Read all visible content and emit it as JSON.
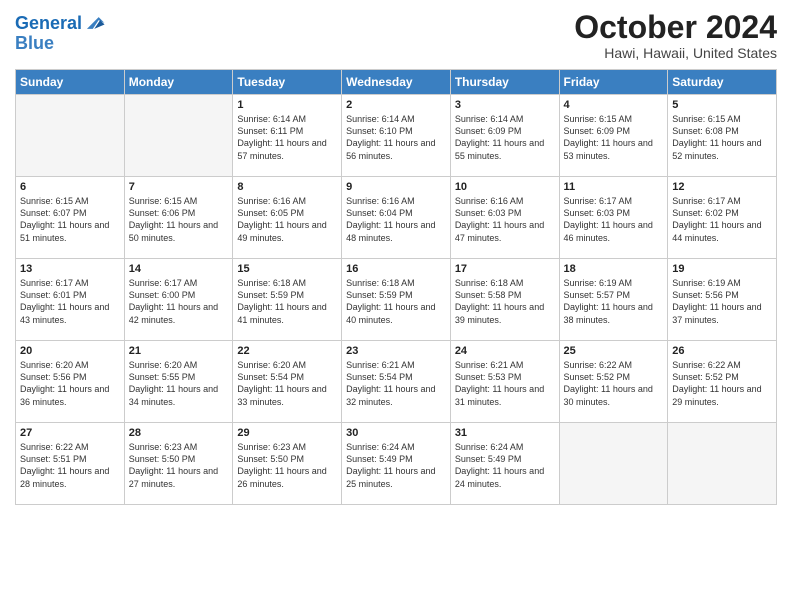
{
  "header": {
    "logo_line1": "General",
    "logo_line2": "Blue",
    "month": "October 2024",
    "location": "Hawi, Hawaii, United States"
  },
  "weekdays": [
    "Sunday",
    "Monday",
    "Tuesday",
    "Wednesday",
    "Thursday",
    "Friday",
    "Saturday"
  ],
  "weeks": [
    [
      {
        "day": "",
        "empty": true
      },
      {
        "day": "",
        "empty": true
      },
      {
        "day": "1",
        "sunrise": "Sunrise: 6:14 AM",
        "sunset": "Sunset: 6:11 PM",
        "daylight": "Daylight: 11 hours and 57 minutes."
      },
      {
        "day": "2",
        "sunrise": "Sunrise: 6:14 AM",
        "sunset": "Sunset: 6:10 PM",
        "daylight": "Daylight: 11 hours and 56 minutes."
      },
      {
        "day": "3",
        "sunrise": "Sunrise: 6:14 AM",
        "sunset": "Sunset: 6:09 PM",
        "daylight": "Daylight: 11 hours and 55 minutes."
      },
      {
        "day": "4",
        "sunrise": "Sunrise: 6:15 AM",
        "sunset": "Sunset: 6:09 PM",
        "daylight": "Daylight: 11 hours and 53 minutes."
      },
      {
        "day": "5",
        "sunrise": "Sunrise: 6:15 AM",
        "sunset": "Sunset: 6:08 PM",
        "daylight": "Daylight: 11 hours and 52 minutes."
      }
    ],
    [
      {
        "day": "6",
        "sunrise": "Sunrise: 6:15 AM",
        "sunset": "Sunset: 6:07 PM",
        "daylight": "Daylight: 11 hours and 51 minutes."
      },
      {
        "day": "7",
        "sunrise": "Sunrise: 6:15 AM",
        "sunset": "Sunset: 6:06 PM",
        "daylight": "Daylight: 11 hours and 50 minutes."
      },
      {
        "day": "8",
        "sunrise": "Sunrise: 6:16 AM",
        "sunset": "Sunset: 6:05 PM",
        "daylight": "Daylight: 11 hours and 49 minutes."
      },
      {
        "day": "9",
        "sunrise": "Sunrise: 6:16 AM",
        "sunset": "Sunset: 6:04 PM",
        "daylight": "Daylight: 11 hours and 48 minutes."
      },
      {
        "day": "10",
        "sunrise": "Sunrise: 6:16 AM",
        "sunset": "Sunset: 6:03 PM",
        "daylight": "Daylight: 11 hours and 47 minutes."
      },
      {
        "day": "11",
        "sunrise": "Sunrise: 6:17 AM",
        "sunset": "Sunset: 6:03 PM",
        "daylight": "Daylight: 11 hours and 46 minutes."
      },
      {
        "day": "12",
        "sunrise": "Sunrise: 6:17 AM",
        "sunset": "Sunset: 6:02 PM",
        "daylight": "Daylight: 11 hours and 44 minutes."
      }
    ],
    [
      {
        "day": "13",
        "sunrise": "Sunrise: 6:17 AM",
        "sunset": "Sunset: 6:01 PM",
        "daylight": "Daylight: 11 hours and 43 minutes."
      },
      {
        "day": "14",
        "sunrise": "Sunrise: 6:17 AM",
        "sunset": "Sunset: 6:00 PM",
        "daylight": "Daylight: 11 hours and 42 minutes."
      },
      {
        "day": "15",
        "sunrise": "Sunrise: 6:18 AM",
        "sunset": "Sunset: 5:59 PM",
        "daylight": "Daylight: 11 hours and 41 minutes."
      },
      {
        "day": "16",
        "sunrise": "Sunrise: 6:18 AM",
        "sunset": "Sunset: 5:59 PM",
        "daylight": "Daylight: 11 hours and 40 minutes."
      },
      {
        "day": "17",
        "sunrise": "Sunrise: 6:18 AM",
        "sunset": "Sunset: 5:58 PM",
        "daylight": "Daylight: 11 hours and 39 minutes."
      },
      {
        "day": "18",
        "sunrise": "Sunrise: 6:19 AM",
        "sunset": "Sunset: 5:57 PM",
        "daylight": "Daylight: 11 hours and 38 minutes."
      },
      {
        "day": "19",
        "sunrise": "Sunrise: 6:19 AM",
        "sunset": "Sunset: 5:56 PM",
        "daylight": "Daylight: 11 hours and 37 minutes."
      }
    ],
    [
      {
        "day": "20",
        "sunrise": "Sunrise: 6:20 AM",
        "sunset": "Sunset: 5:56 PM",
        "daylight": "Daylight: 11 hours and 36 minutes."
      },
      {
        "day": "21",
        "sunrise": "Sunrise: 6:20 AM",
        "sunset": "Sunset: 5:55 PM",
        "daylight": "Daylight: 11 hours and 34 minutes."
      },
      {
        "day": "22",
        "sunrise": "Sunrise: 6:20 AM",
        "sunset": "Sunset: 5:54 PM",
        "daylight": "Daylight: 11 hours and 33 minutes."
      },
      {
        "day": "23",
        "sunrise": "Sunrise: 6:21 AM",
        "sunset": "Sunset: 5:54 PM",
        "daylight": "Daylight: 11 hours and 32 minutes."
      },
      {
        "day": "24",
        "sunrise": "Sunrise: 6:21 AM",
        "sunset": "Sunset: 5:53 PM",
        "daylight": "Daylight: 11 hours and 31 minutes."
      },
      {
        "day": "25",
        "sunrise": "Sunrise: 6:22 AM",
        "sunset": "Sunset: 5:52 PM",
        "daylight": "Daylight: 11 hours and 30 minutes."
      },
      {
        "day": "26",
        "sunrise": "Sunrise: 6:22 AM",
        "sunset": "Sunset: 5:52 PM",
        "daylight": "Daylight: 11 hours and 29 minutes."
      }
    ],
    [
      {
        "day": "27",
        "sunrise": "Sunrise: 6:22 AM",
        "sunset": "Sunset: 5:51 PM",
        "daylight": "Daylight: 11 hours and 28 minutes."
      },
      {
        "day": "28",
        "sunrise": "Sunrise: 6:23 AM",
        "sunset": "Sunset: 5:50 PM",
        "daylight": "Daylight: 11 hours and 27 minutes."
      },
      {
        "day": "29",
        "sunrise": "Sunrise: 6:23 AM",
        "sunset": "Sunset: 5:50 PM",
        "daylight": "Daylight: 11 hours and 26 minutes."
      },
      {
        "day": "30",
        "sunrise": "Sunrise: 6:24 AM",
        "sunset": "Sunset: 5:49 PM",
        "daylight": "Daylight: 11 hours and 25 minutes."
      },
      {
        "day": "31",
        "sunrise": "Sunrise: 6:24 AM",
        "sunset": "Sunset: 5:49 PM",
        "daylight": "Daylight: 11 hours and 24 minutes."
      },
      {
        "day": "",
        "empty": true
      },
      {
        "day": "",
        "empty": true
      }
    ]
  ]
}
